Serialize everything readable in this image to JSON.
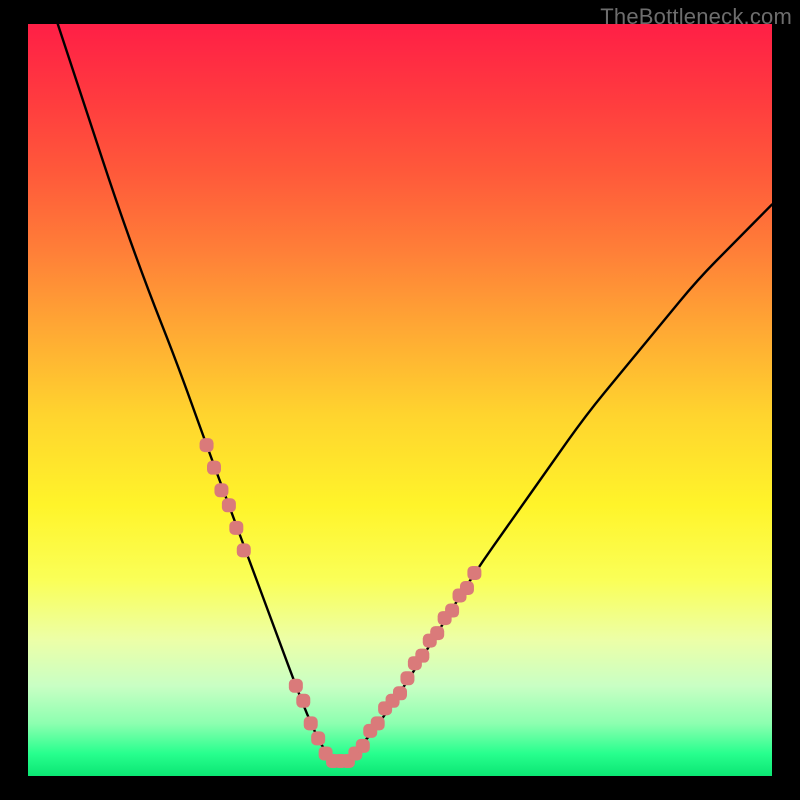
{
  "attribution": "TheBottleneck.com",
  "chart_data": {
    "type": "line",
    "title": "",
    "xlabel": "",
    "ylabel": "",
    "xlim": [
      0,
      100
    ],
    "ylim": [
      0,
      100
    ],
    "curve": {
      "name": "bottleneck-curve",
      "x": [
        4,
        8,
        12,
        16,
        20,
        24,
        27,
        30,
        33,
        36,
        38,
        40,
        42,
        45,
        50,
        55,
        60,
        65,
        70,
        75,
        80,
        85,
        90,
        95,
        100
      ],
      "y": [
        100,
        88,
        76,
        65,
        55,
        44,
        36,
        28,
        20,
        12,
        7,
        3,
        2,
        4,
        11,
        19,
        27,
        34,
        41,
        48,
        54,
        60,
        66,
        71,
        76
      ]
    },
    "markers": {
      "name": "highlight-band",
      "color": "#da7a7a",
      "points": [
        {
          "x": 24,
          "y": 44
        },
        {
          "x": 25,
          "y": 41
        },
        {
          "x": 26,
          "y": 38
        },
        {
          "x": 27,
          "y": 36
        },
        {
          "x": 28,
          "y": 33
        },
        {
          "x": 29,
          "y": 30
        },
        {
          "x": 36,
          "y": 12
        },
        {
          "x": 37,
          "y": 10
        },
        {
          "x": 38,
          "y": 7
        },
        {
          "x": 39,
          "y": 5
        },
        {
          "x": 40,
          "y": 3
        },
        {
          "x": 41,
          "y": 2
        },
        {
          "x": 42,
          "y": 2
        },
        {
          "x": 43,
          "y": 2
        },
        {
          "x": 44,
          "y": 3
        },
        {
          "x": 45,
          "y": 4
        },
        {
          "x": 46,
          "y": 6
        },
        {
          "x": 47,
          "y": 7
        },
        {
          "x": 48,
          "y": 9
        },
        {
          "x": 49,
          "y": 10
        },
        {
          "x": 50,
          "y": 11
        },
        {
          "x": 51,
          "y": 13
        },
        {
          "x": 52,
          "y": 15
        },
        {
          "x": 53,
          "y": 16
        },
        {
          "x": 54,
          "y": 18
        },
        {
          "x": 55,
          "y": 19
        },
        {
          "x": 56,
          "y": 21
        },
        {
          "x": 57,
          "y": 22
        },
        {
          "x": 58,
          "y": 24
        },
        {
          "x": 59,
          "y": 25
        },
        {
          "x": 60,
          "y": 27
        }
      ]
    }
  }
}
